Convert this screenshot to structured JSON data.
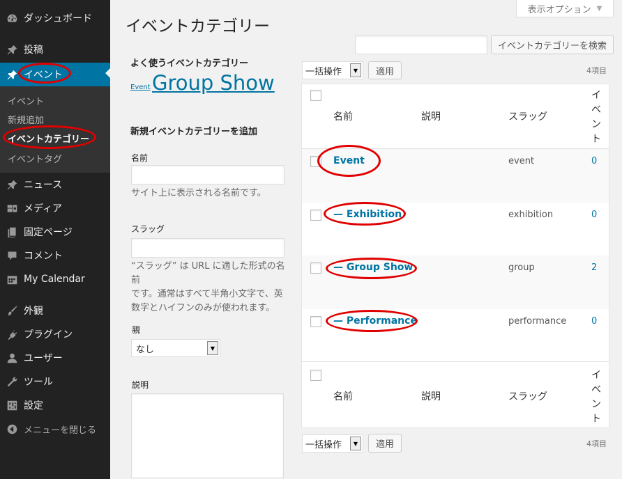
{
  "sidebar": {
    "items": [
      {
        "label": "ダッシュボード",
        "icon": "dashboard-icon"
      },
      {
        "label": "投稿",
        "icon": "pin-icon"
      },
      {
        "label": "イベント",
        "icon": "pin-icon"
      },
      {
        "label": "ニュース",
        "icon": "pin-icon"
      },
      {
        "label": "メディア",
        "icon": "media-icon"
      },
      {
        "label": "固定ページ",
        "icon": "page-icon"
      },
      {
        "label": "コメント",
        "icon": "comment-icon"
      },
      {
        "label": "My Calendar",
        "icon": "calendar-icon"
      },
      {
        "label": "外観",
        "icon": "brush-icon"
      },
      {
        "label": "プラグイン",
        "icon": "plugin-icon"
      },
      {
        "label": "ユーザー",
        "icon": "user-icon"
      },
      {
        "label": "ツール",
        "icon": "wrench-icon"
      },
      {
        "label": "設定",
        "icon": "settings-icon"
      },
      {
        "label": "メニューを閉じる",
        "icon": "collapse-icon"
      }
    ],
    "submenu": [
      "イベント",
      "新規追加",
      "イベントカテゴリー",
      "イベントタグ"
    ]
  },
  "header": {
    "title": "イベントカテゴリー",
    "screen_options": "表示オプション"
  },
  "search": {
    "value": "",
    "button": "イベントカテゴリーを検索"
  },
  "popular": {
    "heading": "よく使うイベントカテゴリー",
    "tags": [
      "Event",
      "Group Show"
    ]
  },
  "form": {
    "heading": "新規イベントカテゴリーを追加",
    "name_label": "名前",
    "name_value": "",
    "name_desc": "サイト上に表示される名前です。",
    "slug_label": "スラッグ",
    "slug_value": "",
    "slug_desc": [
      "“スラッグ” は URL に適した形式の名前",
      "です。通常はすべて半角小文字で、英",
      "数字とハイフンのみが使われます。"
    ],
    "parent_label": "親",
    "parent_value": "なし",
    "description_label": "説明",
    "description_value": ""
  },
  "bulk": {
    "select": "一括操作",
    "apply": "適用",
    "items_count": "4項目"
  },
  "table": {
    "columns": {
      "name": "名前",
      "description": "説明",
      "slug": "スラッグ",
      "count": [
        "イ",
        "ベ",
        "ン",
        "ト"
      ]
    },
    "rows": [
      {
        "name": "Event",
        "slug": "event",
        "count": "0"
      },
      {
        "name": "— Exhibition",
        "slug": "exhibition",
        "count": "0"
      },
      {
        "name": "— Group Show",
        "slug": "group",
        "count": "2"
      },
      {
        "name": "— Performance",
        "slug": "performance",
        "count": "0"
      }
    ]
  },
  "colors": {
    "sidebar_bg": "#222222",
    "active_bg": "#0074a2",
    "link": "#0074a2",
    "highlight": "#e00000"
  }
}
